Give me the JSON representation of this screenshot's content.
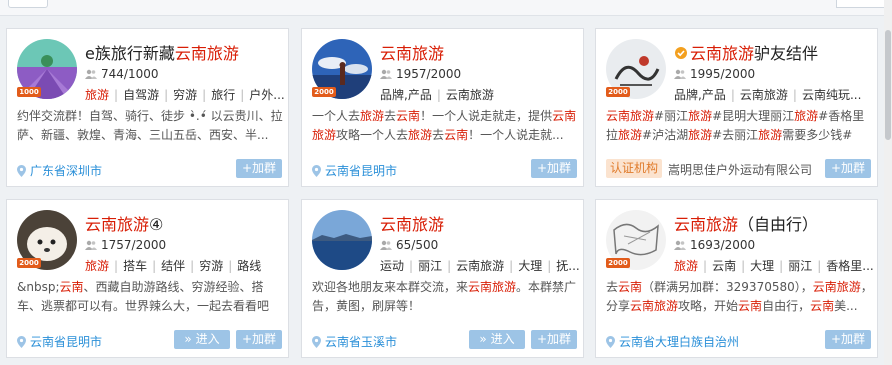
{
  "cards": [
    {
      "title_prefix": "e族旅行新藏",
      "title_hl": "云南旅游",
      "title_suffix": "",
      "members": "744/1000",
      "level": "1000",
      "tags": [
        "旅游",
        "自驾游",
        "穷游",
        "旅行",
        "户外..."
      ],
      "tag_hl": [
        true,
        false,
        false,
        false,
        false
      ],
      "desc": "约伴交流群！自驾、骑行、徒步 •̀.•́ 以云贵川、拉萨、新疆、敦煌、青海、三山五岳、西安、半...",
      "location": "广东省深圳市",
      "add_label": "+加群"
    },
    {
      "title_prefix": "",
      "title_hl": "云南旅游",
      "title_suffix": "",
      "members": "1957/2000",
      "level": "2000",
      "tags": [
        "品牌,产品",
        "云南旅游"
      ],
      "tag_hl": [
        false,
        false
      ],
      "desc_parts": [
        "一个人去",
        "旅游",
        "去",
        "云南",
        "！一个人说走就走，提供",
        "云南旅游",
        "攻略一个人去",
        "旅游",
        "去",
        "云南",
        "！一个人说走就..."
      ],
      "location": "云南省昆明市",
      "add_label": "+加群"
    },
    {
      "title_prefix": "",
      "title_hl": "云南旅游",
      "title_suffix": "驴友结伴",
      "members": "1995/2000",
      "level": "2000",
      "tags": [
        "品牌,产品",
        "云南旅游",
        "云南纯玩..."
      ],
      "tag_hl": [
        false,
        false,
        false
      ],
      "desc_parts": [
        "云南旅游",
        "#丽江",
        "旅游",
        "#昆明大理丽江",
        "旅游",
        "#香格里拉",
        "旅游",
        "#泸沽湖",
        "旅游",
        "#去丽江",
        "旅游",
        "需要多少钱#在..."
      ],
      "cert_label": "认证机构",
      "org_name": "嵩明思佳户外运动有限公司",
      "add_label": "+加群"
    },
    {
      "title_prefix": "",
      "title_hl": "云南旅游",
      "title_suffix": "④",
      "members": "1757/2000",
      "level": "2000",
      "tags": [
        "旅游",
        "搭车",
        "结伴",
        "穷游",
        "路线"
      ],
      "tag_hl": [
        true,
        false,
        false,
        false,
        false
      ],
      "desc_parts": [
        "&nbsp;",
        "云南",
        "、西藏自助游路线、穷游经验、搭车、逃票都可以有。世界辣么大，一起去看看吧"
      ],
      "location": "云南省昆明市",
      "enter_label": "» 进入",
      "add_label": "+加群"
    },
    {
      "title_prefix": "",
      "title_hl": "云南旅游",
      "title_suffix": "",
      "members": "65/500",
      "level": "",
      "tags": [
        "运动",
        "丽江",
        "云南旅游",
        "大理",
        "抚..."
      ],
      "tag_hl": [
        false,
        false,
        false,
        false,
        false
      ],
      "desc_parts": [
        "欢迎各地朋友来本群交流，来",
        "云南旅游",
        "。本群禁广告，黄图，刷屏等！"
      ],
      "location": "云南省玉溪市",
      "enter_label": "» 进入",
      "add_label": "+加群"
    },
    {
      "title_prefix": "",
      "title_hl": "云南旅游",
      "title_suffix": "（自由行）",
      "members": "1693/2000",
      "level": "2000",
      "tags": [
        "旅游",
        "云南",
        "大理",
        "丽江",
        "香格里..."
      ],
      "tag_hl": [
        true,
        false,
        false,
        false,
        false
      ],
      "desc_parts": [
        "去",
        "云南",
        "（群满另加群：329370580），",
        "云南旅游",
        "，分享",
        "云南旅游",
        "攻略，开始",
        "云南",
        "自由行，",
        "云南",
        "美..."
      ],
      "location": "云南省大理白族自治州",
      "add_label": "+加群"
    }
  ],
  "colors": {
    "highlight": "#d81e06",
    "link": "#2a8fd8",
    "button": "#9dc4e6",
    "level": "#e25c1b"
  }
}
